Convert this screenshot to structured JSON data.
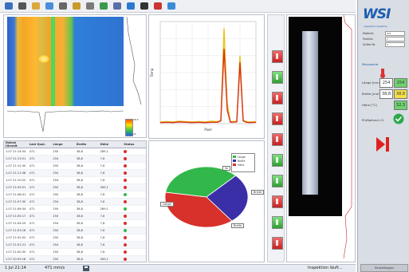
{
  "toolbar": {
    "icons": [
      "open-icon",
      "camera-icon",
      "folder-icon",
      "globe-icon",
      "print-icon",
      "export-icon",
      "tools-icon",
      "chart-icon",
      "user-icon",
      "help-icon",
      "settings-icon",
      "color-icon",
      "refresh-icon"
    ]
  },
  "thermal": {
    "scale_max": "28.5",
    "scale_mid": "",
    "scale_min": "22"
  },
  "table": {
    "headers": [
      "Datum Uhrzeit",
      "Last Qual.",
      "Länge",
      "Breite",
      "Höhe",
      "Status"
    ],
    "rows": [
      [
        "1.07 21:14:54",
        "471",
        "250",
        "38,8",
        "269,1",
        "red"
      ],
      [
        "1.07 21:13:51",
        "471",
        "254",
        "38,8",
        "7,6",
        "red"
      ],
      [
        "1.07 21:12:30",
        "471",
        "250",
        "38,8",
        "7,6",
        "red"
      ],
      [
        "1.07 21:11:38",
        "471",
        "250",
        "38,8",
        "7,6",
        "red"
      ],
      [
        "1.07 21:10:22",
        "471",
        "254",
        "38,8",
        "7,6",
        "red"
      ],
      [
        "1.07 21:09:51",
        "471",
        "250",
        "38,8",
        "269,1",
        "red"
      ],
      [
        "1.07 21:08:41",
        "471",
        "250",
        "38,8",
        "7,6",
        "green"
      ],
      [
        "1.07 21:07:30",
        "471",
        "254",
        "38,8",
        "7,6",
        "red"
      ],
      [
        "1.07 21:06:34",
        "471",
        "250",
        "38,8",
        "269,1",
        "green"
      ],
      [
        "1.07 21:05:17",
        "471",
        "250",
        "38,8",
        "7,6",
        "red"
      ],
      [
        "1.07 21:04:29",
        "471",
        "254",
        "38,8",
        "7,6",
        "red"
      ],
      [
        "1.07 21:03:18",
        "471",
        "250",
        "38,8",
        "7,6",
        "green"
      ],
      [
        "1.07 21:02:02",
        "471",
        "250",
        "38,8",
        "7,6",
        "red"
      ],
      [
        "1.07 21:01:21",
        "471",
        "254",
        "38,8",
        "7,6",
        "red"
      ],
      [
        "1.07 21:00:35",
        "471",
        "250",
        "38,8",
        "7,6",
        "red"
      ],
      [
        "1.07 20:59:18",
        "471",
        "250",
        "38,8",
        "269,1",
        "red"
      ],
      [
        "1.07 20:58:04",
        "471",
        "254",
        "38,8",
        "7,6",
        "green"
      ],
      [
        "1.07 20:57:06",
        "471",
        "250",
        "38,8",
        "7,6",
        "red"
      ],
      [
        "1.07 20:56:17",
        "471",
        "250",
        "38,8",
        "7,6",
        "red"
      ]
    ]
  },
  "chart_data": [
    {
      "type": "line",
      "xlabel": "Pixel",
      "ylabel": "Temp",
      "ylim": [
        0,
        30
      ],
      "xlim": [
        0,
        30
      ],
      "series": [
        {
          "name": "",
          "color": "#e8c21c",
          "x": [
            0,
            2,
            4,
            6,
            8,
            10,
            12,
            14,
            16,
            18,
            19,
            20,
            21,
            22,
            24,
            25,
            26,
            27,
            28,
            30
          ],
          "y": [
            0.5,
            0.6,
            0.5,
            0.7,
            0.6,
            0.5,
            0.6,
            0.5,
            0.7,
            0.6,
            1,
            28,
            6,
            0.6,
            0.7,
            20,
            1,
            0.6,
            0.5,
            0.6
          ]
        },
        {
          "name": "",
          "color": "#d9321a",
          "x": [
            0,
            2,
            4,
            6,
            8,
            10,
            12,
            14,
            16,
            18,
            19,
            20,
            21,
            22,
            24,
            25,
            26,
            27,
            28,
            30
          ],
          "y": [
            0.3,
            0.4,
            0.3,
            0.5,
            0.4,
            0.3,
            0.4,
            0.3,
            0.4,
            0.4,
            0.8,
            22,
            4,
            0.4,
            0.5,
            18,
            0.8,
            0.4,
            0.3,
            0.4
          ]
        }
      ]
    },
    {
      "type": "pie",
      "categories": [
        "Lange",
        "Breite",
        "Hohe"
      ],
      "values": [
        35,
        27,
        38
      ],
      "colors": [
        "#32b84a",
        "#3b2fa8",
        "#d8302a"
      ],
      "legend": "top-right"
    }
  ],
  "pie_labels": [
    "kk",
    "Breite",
    "Länge",
    "Breite"
  ],
  "legend": {
    "items": [
      "Länge",
      "Breite",
      "Höhe"
    ]
  },
  "indicators": [
    "red",
    "green",
    "red",
    "red",
    "red",
    "green",
    "green",
    "red",
    "green",
    "red"
  ],
  "sidebar": {
    "logo": "WSI",
    "logo_sub": "Inspektion-Systeme",
    "info": [
      {
        "label": "Material",
        "value": "471"
      },
      {
        "label": "Position",
        "value": "1"
      },
      {
        "label": "Artikel Nr.",
        "value": "2"
      }
    ],
    "section": "Messwerte",
    "measurements": [
      {
        "label": "Länge [mm]",
        "value": "254",
        "ref": "254"
      },
      {
        "label": "Breite [mm]",
        "value": "38,8",
        "ref": "38,8"
      },
      {
        "label": "Höhe [°C]",
        "value": "",
        "ref": "32,3"
      }
    ],
    "result_label": "Prüfbefund i.O.",
    "footer": "Einstellungen"
  },
  "status": {
    "date": "1 Jul 21:14",
    "speed": "471 mm/s",
    "message": "Inspektion läuft..."
  },
  "colors": {
    "accent": "#1b5fb0",
    "red": "#d8302a",
    "green": "#32b84a"
  }
}
